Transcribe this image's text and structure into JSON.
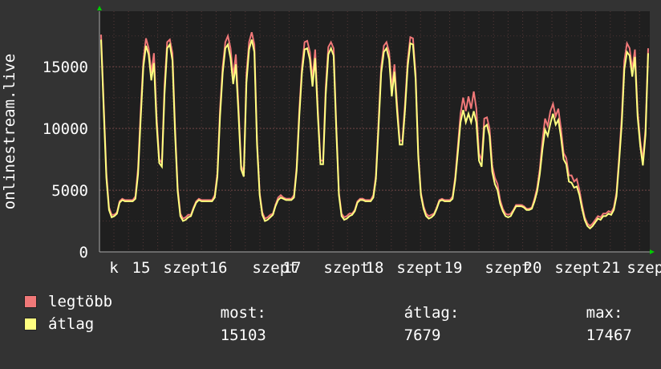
{
  "chart_data": {
    "type": "line",
    "ylabel": "onlinestream.live",
    "ylim": [
      0,
      19500
    ],
    "yticks": [
      0,
      5000,
      10000,
      15000
    ],
    "x_tick_labels": [
      "k",
      "15",
      "szept",
      "16",
      "szept",
      "17",
      "szept",
      "18",
      "szept",
      "19",
      "szept",
      "20",
      "szept",
      "21",
      "szept"
    ],
    "grid": true,
    "colors": {
      "background": "#333333",
      "plot_bg": "#1f1f1f",
      "grid": "#7a4a4a",
      "max": "#f07878",
      "avg": "#ffff80",
      "axis_arrow": "#00cc00"
    },
    "series": [
      {
        "name": "legtöbb",
        "values": [
          17600,
          12000,
          6400,
          3600,
          3000,
          3000,
          3200,
          4100,
          4300,
          4200,
          4200,
          4200,
          4200,
          4500,
          6800,
          11500,
          15500,
          17300,
          16500,
          14500,
          16100,
          11000,
          7500,
          7200,
          13500,
          17000,
          17200,
          16100,
          10000,
          5200,
          3100,
          2700,
          2800,
          3000,
          3000,
          3600,
          4100,
          4300,
          4200,
          4200,
          4200,
          4200,
          4200,
          4600,
          6400,
          11600,
          15000,
          17000,
          17500,
          16500,
          14200,
          16000,
          11800,
          7000,
          6400,
          14400,
          17000,
          17800,
          16800,
          9000,
          4800,
          3200,
          2700,
          2800,
          3000,
          3100,
          3800,
          4400,
          4600,
          4400,
          4300,
          4300,
          4300,
          4600,
          6900,
          11500,
          15000,
          17000,
          17100,
          16200,
          14000,
          16400,
          11600,
          7400,
          7400,
          13300,
          16600,
          17000,
          16500,
          10300,
          4800,
          3100,
          2800,
          2900,
          3100,
          3100,
          3400,
          4100,
          4300,
          4300,
          4200,
          4200,
          4200,
          4600,
          6200,
          10600,
          15000,
          16700,
          17000,
          16200,
          13200,
          15200,
          12000,
          9000,
          9000,
          12000,
          15500,
          17400,
          17300,
          14500,
          8000,
          4800,
          3700,
          3100,
          2900,
          3000,
          3100,
          3600,
          4200,
          4300,
          4200,
          4200,
          4200,
          4500,
          6100,
          8600,
          11200,
          12500,
          11400,
          12600,
          11600,
          13000,
          11600,
          8000,
          7400,
          10800,
          10900,
          10000,
          7000,
          6000,
          5500,
          4200,
          3500,
          3100,
          3000,
          3100,
          3400,
          3800,
          3800,
          3800,
          3700,
          3500,
          3500,
          3600,
          4300,
          5200,
          6700,
          9000,
          10800,
          10200,
          11400,
          12000,
          11000,
          11600,
          10000,
          8000,
          7600,
          6200,
          6200,
          5700,
          5900,
          5000,
          3800,
          2800,
          2300,
          2100,
          2300,
          2600,
          2900,
          2800,
          3100,
          3100,
          3300,
          3200,
          3600,
          4800,
          7700,
          11000,
          15500,
          16900,
          16500,
          14800,
          16400,
          11400,
          9000,
          7400,
          10000,
          16500
        ]
      },
      {
        "name": "átlag",
        "values": [
          17200,
          11500,
          6000,
          3400,
          2800,
          2900,
          3100,
          4000,
          4200,
          4100,
          4100,
          4100,
          4100,
          4300,
          6300,
          10800,
          15000,
          16700,
          16000,
          13900,
          15300,
          10400,
          7200,
          6900,
          12800,
          16500,
          16800,
          15500,
          9500,
          4900,
          2900,
          2500,
          2600,
          2800,
          2900,
          3500,
          4000,
          4200,
          4100,
          4100,
          4100,
          4100,
          4100,
          4400,
          6100,
          11000,
          14500,
          16500,
          16800,
          15700,
          13600,
          15200,
          11200,
          6700,
          6100,
          13700,
          16400,
          17200,
          16200,
          8700,
          4600,
          3000,
          2500,
          2600,
          2800,
          3000,
          3700,
          4200,
          4400,
          4300,
          4200,
          4200,
          4200,
          4400,
          6600,
          11000,
          14500,
          16400,
          16500,
          15600,
          13400,
          15700,
          11100,
          7100,
          7100,
          12700,
          16000,
          16500,
          15900,
          9900,
          4600,
          2900,
          2600,
          2700,
          2900,
          3000,
          3300,
          4000,
          4200,
          4200,
          4100,
          4100,
          4100,
          4400,
          5900,
          10100,
          14500,
          16200,
          16500,
          15600,
          12600,
          14600,
          11400,
          8700,
          8700,
          11500,
          15000,
          16900,
          16800,
          14000,
          7700,
          4600,
          3500,
          2900,
          2700,
          2800,
          3000,
          3500,
          4100,
          4200,
          4100,
          4100,
          4100,
          4300,
          5800,
          8100,
          10500,
          11500,
          10500,
          11200,
          10500,
          11400,
          10500,
          7400,
          6900,
          10100,
          10300,
          9400,
          6500,
          5500,
          5000,
          3900,
          3300,
          2900,
          2800,
          2900,
          3300,
          3700,
          3700,
          3700,
          3600,
          3400,
          3400,
          3500,
          4100,
          4900,
          6300,
          8300,
          9900,
          9400,
          10400,
          11200,
          10300,
          10700,
          9300,
          7500,
          7100,
          5700,
          5600,
          5200,
          5300,
          4600,
          3500,
          2600,
          2100,
          1900,
          2100,
          2400,
          2700,
          2600,
          2900,
          2900,
          3100,
          3000,
          3400,
          4500,
          7300,
          10400,
          14800,
          16200,
          15900,
          14200,
          15800,
          11000,
          8600,
          7000,
          9500,
          16100
        ]
      }
    ]
  },
  "legend": {
    "max_label": "legtöbb",
    "avg_label": "átlag",
    "now_label": "most:",
    "now_value": "15103",
    "avg_stat_label": "átlag:",
    "avg_stat_value": "7679",
    "max_stat_label": "max:",
    "max_stat_value": "17467"
  }
}
